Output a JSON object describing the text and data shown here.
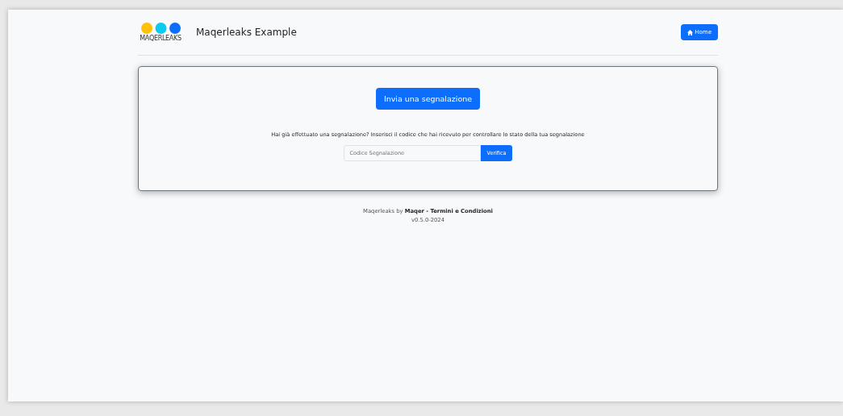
{
  "header": {
    "logo_text": "MAQERLEAKS",
    "title": "Maqerleaks Example",
    "home_button": "Home"
  },
  "card": {
    "submit_button": "Invia una segnalazione",
    "prompt": "Hai già effettuato una segnalazione? Inserisci il codice che hai ricevuto per controllare lo stato della tua segnalazione",
    "code_field": {
      "placeholder": "Codice Segnalazione"
    },
    "verify_button": "Verifica"
  },
  "footer": {
    "credit": "Maqerleaks by **Maqer - Termini e Condizioni**",
    "version": "v0.5.0-2024"
  }
}
